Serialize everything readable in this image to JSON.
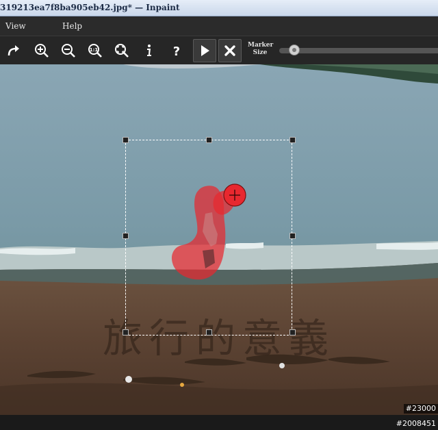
{
  "window": {
    "title": "319213ea7f8ba905eb42.jpg* — Inpaint"
  },
  "menu": [
    {
      "label": "View"
    },
    {
      "label": "Help"
    }
  ],
  "toolbar": {
    "buttons": [
      "redo-icon",
      "zoom-in-icon",
      "zoom-out-icon",
      "zoom-actual-icon",
      "zoom-fit-icon",
      "info-icon",
      "help-icon",
      "run-icon",
      "cancel-icon"
    ],
    "marker_label_line1": "Marker",
    "marker_label_line2": "Size",
    "marker_size_fraction": 0.06
  },
  "canvas": {
    "sand_text": "旅行的意義",
    "badge_top": "#23000",
    "badge_bottom": "#2008451"
  },
  "colors": {
    "marker": "#e8282f",
    "toolbar_bg": "#262626",
    "titlebar_text": "#1b2a44"
  }
}
